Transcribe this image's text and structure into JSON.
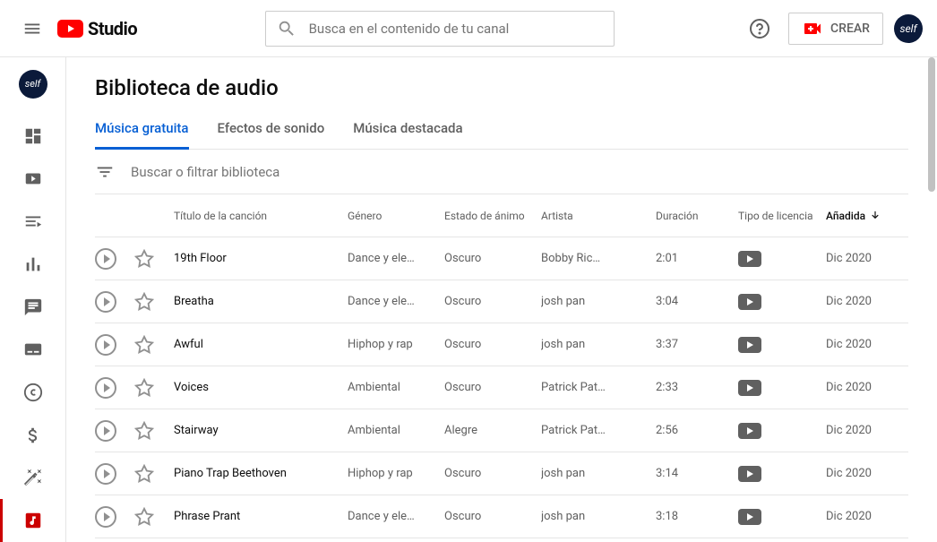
{
  "header": {
    "studio_label": "Studio",
    "search_placeholder": "Busca en el contenido de tu canal",
    "create_label": "CREAR",
    "avatar_text": "self"
  },
  "page": {
    "title": "Biblioteca de audio"
  },
  "tabs": [
    {
      "label": "Música gratuita",
      "active": true
    },
    {
      "label": "Efectos de sonido",
      "active": false
    },
    {
      "label": "Música destacada",
      "active": false
    }
  ],
  "filter": {
    "placeholder": "Buscar o filtrar biblioteca"
  },
  "columns": {
    "title": "Título de la canción",
    "genre": "Género",
    "mood": "Estado de ánimo",
    "artist": "Artista",
    "duration": "Duración",
    "license": "Tipo de licencia",
    "added": "Añadida"
  },
  "tracks": [
    {
      "title": "19th Floor",
      "genre": "Dance y ele…",
      "mood": "Oscuro",
      "artist": "Bobby Ric…",
      "duration": "2:01",
      "added": "Dic 2020"
    },
    {
      "title": "Breatha",
      "genre": "Dance y ele…",
      "mood": "Oscuro",
      "artist": "josh pan",
      "duration": "3:04",
      "added": "Dic 2020"
    },
    {
      "title": "Awful",
      "genre": "Hiphop y rap",
      "mood": "Oscuro",
      "artist": "josh pan",
      "duration": "3:37",
      "added": "Dic 2020"
    },
    {
      "title": "Voices",
      "genre": "Ambiental",
      "mood": "Oscuro",
      "artist": "Patrick Pat…",
      "duration": "2:33",
      "added": "Dic 2020"
    },
    {
      "title": "Stairway",
      "genre": "Ambiental",
      "mood": "Alegre",
      "artist": "Patrick Pat…",
      "duration": "2:56",
      "added": "Dic 2020"
    },
    {
      "title": "Piano Trap Beethoven",
      "genre": "Hiphop y rap",
      "mood": "Oscuro",
      "artist": "josh pan",
      "duration": "3:14",
      "added": "Dic 2020"
    },
    {
      "title": "Phrase Prant",
      "genre": "Dance y ele…",
      "mood": "Oscuro",
      "artist": "josh pan",
      "duration": "3:18",
      "added": "Dic 2020"
    }
  ]
}
